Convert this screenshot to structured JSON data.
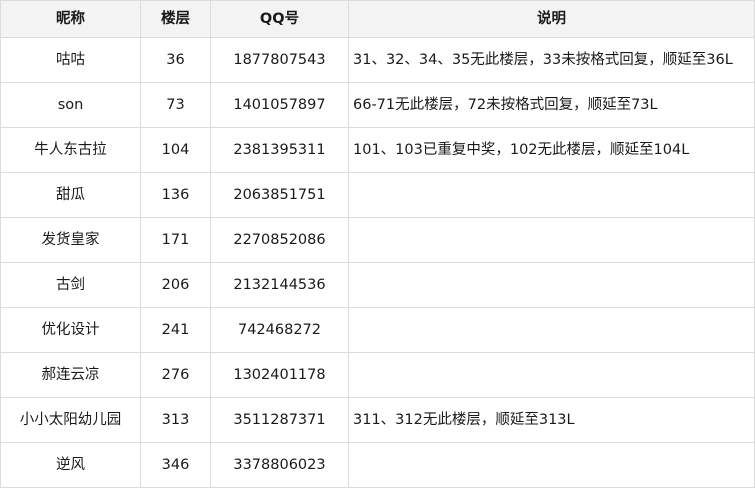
{
  "table": {
    "headers": {
      "nickname": "昵称",
      "floor": "楼层",
      "qq": "QQ号",
      "note": "说明"
    },
    "rows": [
      {
        "nickname": "咕咕",
        "floor": "36",
        "qq": "1877807543",
        "note": "31、32、34、35无此楼层，33未按格式回复，顺延至36L"
      },
      {
        "nickname": "son",
        "floor": "73",
        "qq": "1401057897",
        "note": "66-71无此楼层，72未按格式回复，顺延至73L"
      },
      {
        "nickname": "牛人东古拉",
        "floor": "104",
        "qq": "2381395311",
        "note": "101、103已重复中奖，102无此楼层，顺延至104L"
      },
      {
        "nickname": "甜瓜",
        "floor": "136",
        "qq": "2063851751",
        "note": ""
      },
      {
        "nickname": "发货皇家",
        "floor": "171",
        "qq": "2270852086",
        "note": ""
      },
      {
        "nickname": "古剑",
        "floor": "206",
        "qq": "2132144536",
        "note": ""
      },
      {
        "nickname": "优化设计",
        "floor": "241",
        "qq": "742468272",
        "note": ""
      },
      {
        "nickname": "郝连云凉",
        "floor": "276",
        "qq": "1302401178",
        "note": ""
      },
      {
        "nickname": "小小太阳幼儿园",
        "floor": "313",
        "qq": "3511287371",
        "note": "311、312无此楼层，顺延至313L"
      },
      {
        "nickname": "逆风",
        "floor": "346",
        "qq": "3378806023",
        "note": ""
      }
    ]
  }
}
